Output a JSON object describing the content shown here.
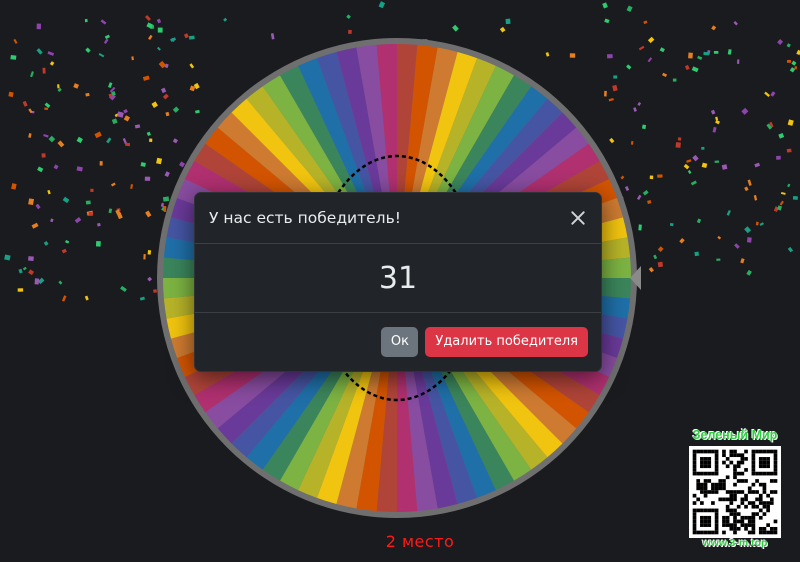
{
  "modal": {
    "title": "У нас есть победитель!",
    "winner_value": "31",
    "ok_label": "Ок",
    "remove_label": "Удалить победителя"
  },
  "place_label": "2 место",
  "watermark": {
    "title": "Зеленый Мир",
    "url": "www.3-m.top"
  },
  "colors": {
    "background": "#1a1b1e",
    "wheel_rim": "#6f6f6f",
    "place_text": "#ff1a1a",
    "danger_button": "#dc3545",
    "secondary_button": "#6c757d",
    "wheel_segments": [
      "#c0392b",
      "#d35400",
      "#e67e22",
      "#f1c40f",
      "#c9c417",
      "#7cb342",
      "#2e8b57",
      "#1f6fa8",
      "#3b4fb0",
      "#6a3a9a",
      "#8e44ad",
      "#b03070"
    ]
  },
  "icons": [
    "close-icon",
    "pointer-icon",
    "qr-code-icon"
  ]
}
